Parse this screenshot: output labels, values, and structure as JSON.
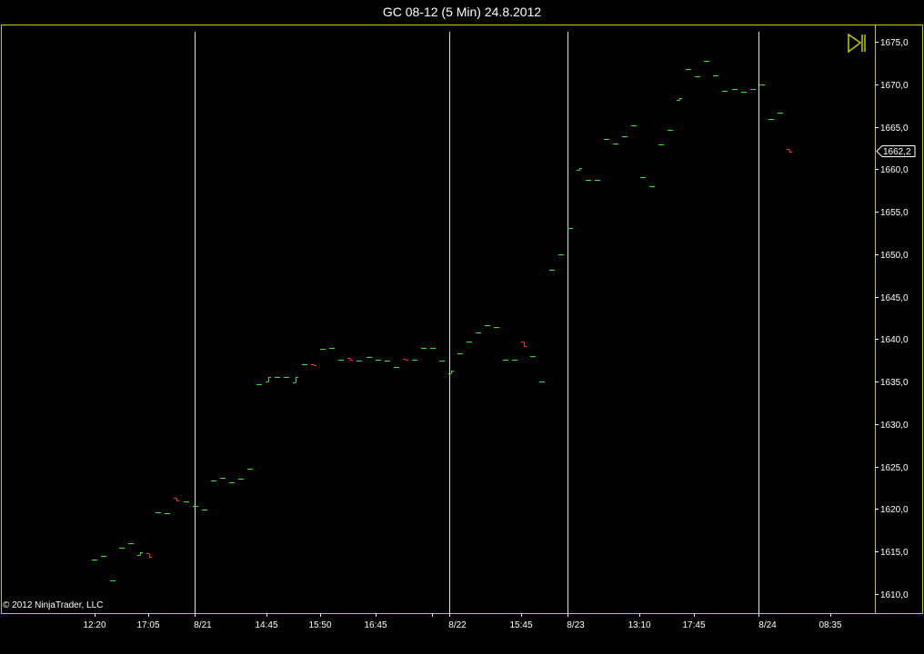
{
  "window": {
    "title": "GC 08-12 (5 Min)  24.8.2012"
  },
  "copyright": "© 2012 NinjaTrader, LLC",
  "colors": {
    "background": "#000000",
    "frame": "#c8c800",
    "up": "#2ee82e",
    "down": "#ff2a2a",
    "divider": "#e0e0e0",
    "text": "#ffffff"
  },
  "icons": {
    "scroll_end": "skip-to-end-icon"
  },
  "chart_data": {
    "type": "ohlc",
    "title": "GC 08-12 (5 Min)  24.8.2012",
    "ylim": [
      1606.5,
      1677.5
    ],
    "y_ticks": [
      "1675,0",
      "1670,0",
      "1665,0",
      "1660,0",
      "1655,0",
      "1650,0",
      "1645,0",
      "1640,0",
      "1635,0",
      "1630,0",
      "1625,0",
      "1620,0",
      "1615,0",
      "1610,0"
    ],
    "x_labels": [
      "12:20",
      "17:05",
      "8/21",
      "14:45",
      "15:50",
      "16:45",
      "8/22",
      "15:45",
      "8/23",
      "13:10",
      "17:45",
      "8/24",
      "08:35"
    ],
    "day_dividers": [
      "8/21",
      "8/22",
      "8/23",
      "8/24"
    ],
    "last_price": "1662,2",
    "grid": false,
    "bars": [
      {
        "o": 1614.1,
        "c": 1614.1,
        "d": "up"
      },
      {
        "o": 1614.5,
        "c": 1614.5,
        "d": "up"
      },
      {
        "o": 1611.6,
        "c": 1611.6,
        "d": "up"
      },
      {
        "o": 1615.5,
        "c": 1615.5,
        "d": "up"
      },
      {
        "o": 1616.0,
        "c": 1616.0,
        "d": "up"
      },
      {
        "o": 1614.6,
        "c": 1614.9,
        "d": "up"
      },
      {
        "o": 1614.8,
        "c": 1614.4,
        "d": "down"
      },
      {
        "o": 1619.6,
        "c": 1619.6,
        "d": "up"
      },
      {
        "o": 1619.5,
        "c": 1619.5,
        "d": "up"
      },
      {
        "o": 1621.3,
        "c": 1621.0,
        "d": "down"
      },
      {
        "o": 1620.9,
        "c": 1620.9,
        "d": "up"
      },
      {
        "o": 1620.4,
        "c": 1620.4,
        "d": "up"
      },
      {
        "o": 1619.9,
        "c": 1619.9,
        "d": "up"
      },
      {
        "o": 1623.4,
        "c": 1623.4,
        "d": "up"
      },
      {
        "o": 1623.7,
        "c": 1623.7,
        "d": "up"
      },
      {
        "o": 1623.1,
        "c": 1623.1,
        "d": "up"
      },
      {
        "o": 1623.6,
        "c": 1623.6,
        "d": "up"
      },
      {
        "o": 1624.8,
        "c": 1624.8,
        "d": "up"
      },
      {
        "o": 1634.7,
        "c": 1634.7,
        "d": "up"
      },
      {
        "o": 1635.0,
        "c": 1635.5,
        "d": "up"
      },
      {
        "o": 1635.5,
        "c": 1635.5,
        "d": "up"
      },
      {
        "o": 1635.5,
        "c": 1635.5,
        "d": "up"
      },
      {
        "o": 1634.9,
        "c": 1635.5,
        "d": "up"
      },
      {
        "o": 1637.1,
        "c": 1637.1,
        "d": "up"
      },
      {
        "o": 1637.1,
        "c": 1636.9,
        "d": "down"
      },
      {
        "o": 1638.9,
        "c": 1638.9,
        "d": "up"
      },
      {
        "o": 1639.0,
        "c": 1639.0,
        "d": "up"
      },
      {
        "o": 1637.6,
        "c": 1637.6,
        "d": "up"
      },
      {
        "o": 1637.8,
        "c": 1637.6,
        "d": "down"
      },
      {
        "o": 1637.5,
        "c": 1637.5,
        "d": "up"
      },
      {
        "o": 1637.9,
        "c": 1637.9,
        "d": "up"
      },
      {
        "o": 1637.6,
        "c": 1637.6,
        "d": "up"
      },
      {
        "o": 1637.5,
        "c": 1637.5,
        "d": "up"
      },
      {
        "o": 1636.7,
        "c": 1636.7,
        "d": "up"
      },
      {
        "o": 1637.7,
        "c": 1637.6,
        "d": "down"
      },
      {
        "o": 1637.6,
        "c": 1637.6,
        "d": "up"
      },
      {
        "o": 1639.0,
        "c": 1639.0,
        "d": "up"
      },
      {
        "o": 1639.0,
        "c": 1639.0,
        "d": "up"
      },
      {
        "o": 1637.5,
        "c": 1637.5,
        "d": "up"
      },
      {
        "o": 1636.0,
        "c": 1636.3,
        "d": "up"
      },
      {
        "o": 1638.3,
        "c": 1638.3,
        "d": "up"
      },
      {
        "o": 1639.7,
        "c": 1639.7,
        "d": "up"
      },
      {
        "o": 1640.8,
        "c": 1640.8,
        "d": "up"
      },
      {
        "o": 1641.6,
        "c": 1641.6,
        "d": "up"
      },
      {
        "o": 1641.4,
        "c": 1641.4,
        "d": "up"
      },
      {
        "o": 1637.6,
        "c": 1637.6,
        "d": "up"
      },
      {
        "o": 1637.6,
        "c": 1637.6,
        "d": "up"
      },
      {
        "o": 1639.7,
        "c": 1639.2,
        "d": "down"
      },
      {
        "o": 1638.0,
        "c": 1638.0,
        "d": "up"
      },
      {
        "o": 1635.0,
        "c": 1635.0,
        "d": "up"
      },
      {
        "o": 1648.2,
        "c": 1648.2,
        "d": "up"
      },
      {
        "o": 1650.0,
        "c": 1650.0,
        "d": "up"
      },
      {
        "o": 1653.1,
        "c": 1653.1,
        "d": "up"
      },
      {
        "o": 1659.9,
        "c": 1660.1,
        "d": "up"
      },
      {
        "o": 1658.8,
        "c": 1658.8,
        "d": "up"
      },
      {
        "o": 1658.8,
        "c": 1658.8,
        "d": "up"
      },
      {
        "o": 1663.6,
        "c": 1663.6,
        "d": "up"
      },
      {
        "o": 1663.0,
        "c": 1663.0,
        "d": "up"
      },
      {
        "o": 1663.9,
        "c": 1663.9,
        "d": "up"
      },
      {
        "o": 1665.2,
        "c": 1665.2,
        "d": "up"
      },
      {
        "o": 1659.1,
        "c": 1659.1,
        "d": "up"
      },
      {
        "o": 1658.0,
        "c": 1658.0,
        "d": "up"
      },
      {
        "o": 1662.9,
        "c": 1662.9,
        "d": "up"
      },
      {
        "o": 1664.6,
        "c": 1664.6,
        "d": "up"
      },
      {
        "o": 1668.2,
        "c": 1668.4,
        "d": "up"
      },
      {
        "o": 1671.8,
        "c": 1671.8,
        "d": "up"
      },
      {
        "o": 1670.9,
        "c": 1670.9,
        "d": "up"
      },
      {
        "o": 1672.8,
        "c": 1672.8,
        "d": "up"
      },
      {
        "o": 1671.0,
        "c": 1671.0,
        "d": "up"
      },
      {
        "o": 1669.2,
        "c": 1669.2,
        "d": "up"
      },
      {
        "o": 1669.4,
        "c": 1669.4,
        "d": "up"
      },
      {
        "o": 1669.1,
        "c": 1669.1,
        "d": "up"
      },
      {
        "o": 1669.4,
        "c": 1669.4,
        "d": "up"
      },
      {
        "o": 1670.0,
        "c": 1670.0,
        "d": "up"
      },
      {
        "o": 1665.9,
        "c": 1665.9,
        "d": "up"
      },
      {
        "o": 1666.7,
        "c": 1666.7,
        "d": "up"
      },
      {
        "o": 1662.4,
        "c": 1662.1,
        "d": "down"
      }
    ]
  }
}
